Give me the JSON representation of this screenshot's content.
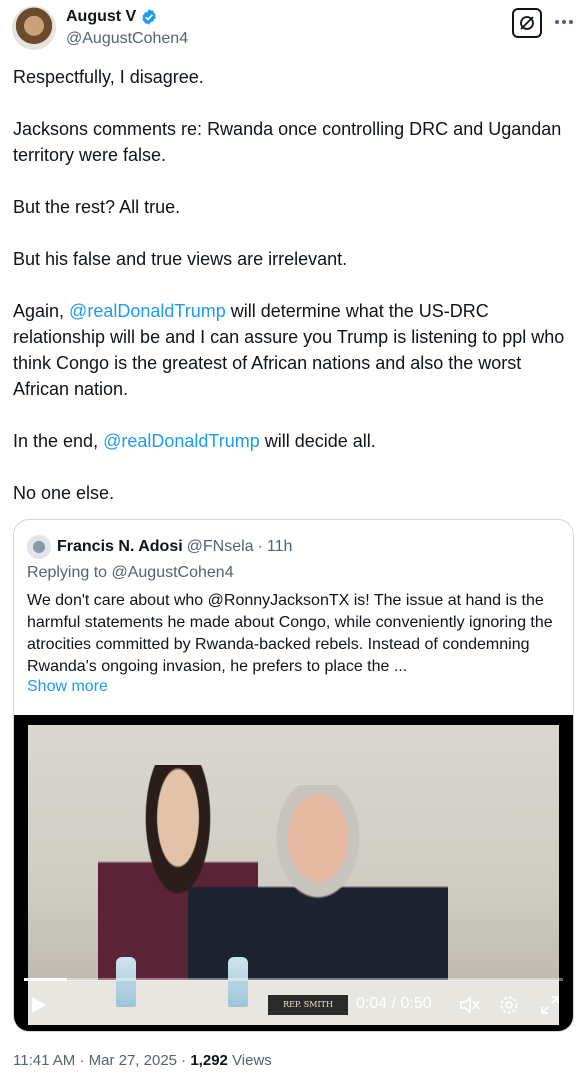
{
  "author": {
    "display_name": "August V",
    "handle": "@AugustCohen4",
    "verified": true,
    "verified_color": "#1d9bf0"
  },
  "header_icons": {
    "grok": "grok-icon",
    "more": "more-horizontal-icon"
  },
  "tweet": {
    "p1": "Respectfully, I disagree.",
    "p2": "Jacksons comments re: Rwanda once controlling DRC and Ugandan territory were false.",
    "p3": "But the rest? All true.",
    "p4": "But his false and true views are irrelevant.",
    "p5_before": "Again, ",
    "p5_mention": "@realDonaldTrump",
    "p5_after": " will determine what the US-DRC relationship will be and I can assure you Trump is listening to ppl who think Congo is the greatest of African nations and also the worst African nation.",
    "p6_before": "In the end, ",
    "p6_mention": "@realDonaldTrump",
    "p6_after": " will decide all.",
    "p7": "No one else."
  },
  "quoted": {
    "display_name": "Francis N. Adosi",
    "handle": "@FNsela",
    "separator": "·",
    "time": "11h",
    "replying_to": "Replying to @AugustCohen4",
    "text": "We don't care about who @RonnyJacksonTX is! The issue at hand is the harmful statements he made about Congo, while conveniently ignoring the atrocities committed by Rwanda-backed rebels. Instead of condemning Rwanda's ongoing invasion, he prefers to place the ...",
    "show_more": "Show more"
  },
  "video": {
    "nameplate": "REP. SMITH",
    "time_display": "0:04 / 0:50",
    "progress": 0.08
  },
  "meta": {
    "time": "11:41 AM",
    "separator": "·",
    "date": "Mar 27, 2025",
    "views_count": "1,292",
    "views_label": "Views"
  },
  "colors": {
    "link": "#1d9bf0",
    "secondary_text": "#536471",
    "border": "#cfd9de"
  }
}
